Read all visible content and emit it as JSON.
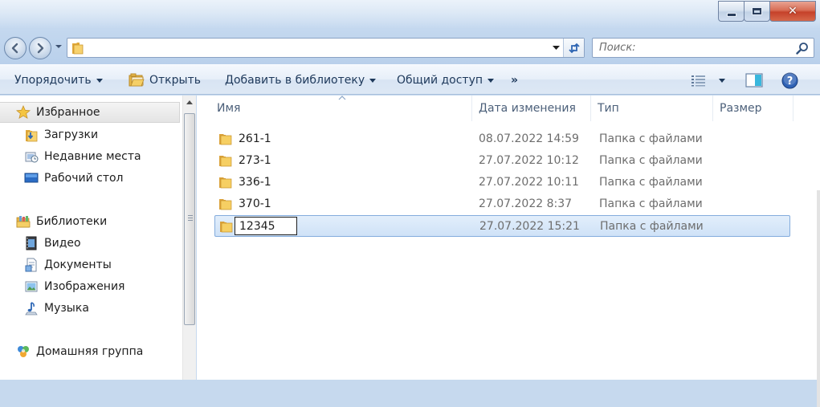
{
  "window": {
    "controls": {
      "minimize_icon": "minimize-icon",
      "maximize_icon": "maximize-icon",
      "close_icon": "close-icon",
      "close_glyph": "✕"
    }
  },
  "navigation": {
    "address_text": "",
    "search_placeholder": "Поиск:"
  },
  "toolbar": {
    "organize_label": "Упорядочить",
    "open_label": "Открыть",
    "add_to_library_label": "Добавить в библиотеку",
    "share_label": "Общий доступ",
    "more_label": "»"
  },
  "sidebar": {
    "favorites": {
      "label": "Избранное",
      "icon": "star-icon"
    },
    "favorites_items": [
      {
        "label": "Загрузки",
        "icon": "downloads-folder-icon"
      },
      {
        "label": "Недавние места",
        "icon": "recent-places-icon"
      },
      {
        "label": "Рабочий стол",
        "icon": "desktop-icon"
      }
    ],
    "libraries": {
      "label": "Библиотеки",
      "icon": "libraries-icon"
    },
    "libraries_items": [
      {
        "label": "Видео",
        "icon": "video-library-icon"
      },
      {
        "label": "Документы",
        "icon": "documents-library-icon"
      },
      {
        "label": "Изображения",
        "icon": "pictures-library-icon"
      },
      {
        "label": "Музыка",
        "icon": "music-library-icon"
      }
    ],
    "homegroup": {
      "label": "Домашняя группа",
      "icon": "homegroup-icon"
    }
  },
  "file_list": {
    "columns": [
      "Имя",
      "Дата изменения",
      "Тип",
      "Размер"
    ],
    "rows": [
      {
        "name": "261-1",
        "modified": "08.07.2022 14:59",
        "type": "Папка с файлами",
        "size": ""
      },
      {
        "name": "273-1",
        "modified": "27.07.2022 10:12",
        "type": "Папка с файлами",
        "size": ""
      },
      {
        "name": "336-1",
        "modified": "27.07.2022 10:11",
        "type": "Папка с файлами",
        "size": ""
      },
      {
        "name": "370-1",
        "modified": "27.07.2022 8:37",
        "type": "Папка с файлами",
        "size": ""
      },
      {
        "name": "12345",
        "modified": "27.07.2022 15:21",
        "type": "Папка с файлами",
        "size": "",
        "selected": true,
        "renaming": true
      }
    ]
  },
  "colors": {
    "chrome_accent": "#c4d8ef",
    "selection_fill": "#cfe2f7",
    "selection_border": "#84acdd",
    "folder_yellow": "#f5c85a",
    "help_blue": "#2f62b5"
  }
}
